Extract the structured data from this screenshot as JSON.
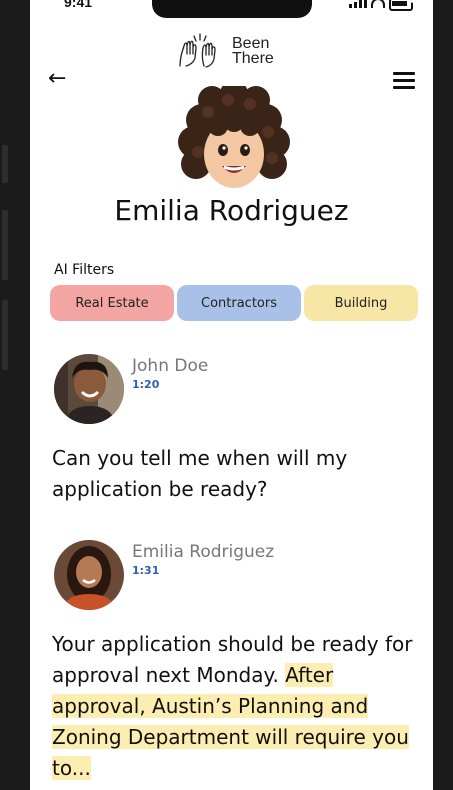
{
  "status_bar": {
    "time": "9:41"
  },
  "brand": {
    "line1": "Been",
    "line2": "There"
  },
  "profile": {
    "name": "Emilia Rodriguez"
  },
  "filters": {
    "label": "AI Filters",
    "chips": [
      {
        "label": "Real Estate",
        "color": "#f2a5a3"
      },
      {
        "label": "Contractors",
        "color": "#a9c1e8"
      },
      {
        "label": "Building",
        "color": "#f8e6a6"
      }
    ]
  },
  "messages": [
    {
      "sender": "John Doe",
      "time": "1:20",
      "text": "Can you tell me when will my application be ready?"
    },
    {
      "sender": "Emilia Rodriguez",
      "time": "1:31",
      "text_plain": "Your application should be ready for approval next Monday. ",
      "text_highlight": "After approval, Austin’s Planning and Zoning Department will require you to..."
    }
  ],
  "colors": {
    "highlight": "#fbeeb0",
    "time_blue": "#2b5fb8"
  }
}
